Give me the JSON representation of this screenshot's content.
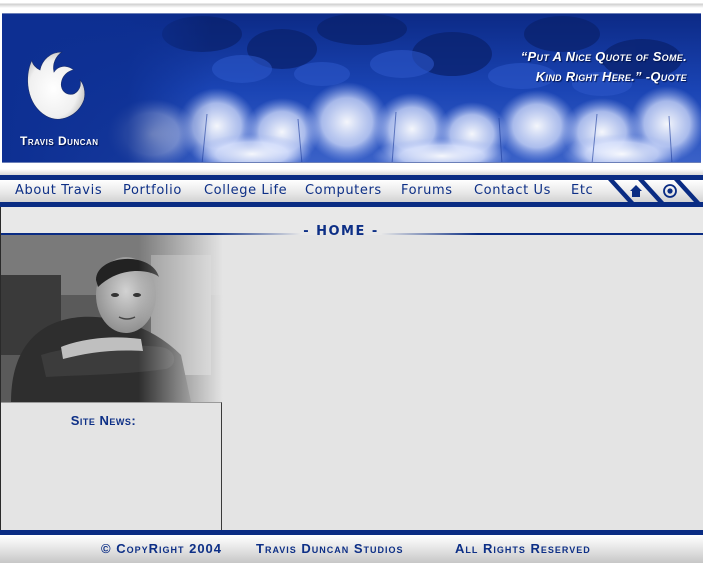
{
  "header": {
    "site_name": "Travis Duncan",
    "quote_line1": "“Put A Nice Quote of Some.",
    "quote_line2": "Kind Right Here.” -Quote"
  },
  "nav": {
    "items": [
      {
        "label": "About Travis"
      },
      {
        "label": "Portfolio"
      },
      {
        "label": "College Life"
      },
      {
        "label": "Computers"
      },
      {
        "label": "Forums"
      },
      {
        "label": "Contact Us"
      },
      {
        "label": "Etc"
      }
    ],
    "icons": [
      "home-icon",
      "target-icon"
    ]
  },
  "main": {
    "page_title": "- HOME -",
    "news_title": "Site News:"
  },
  "footer": {
    "copyright": "© CopyRight 2004",
    "studio": "Travis Duncan Studios",
    "rights": "All Rights Reserved"
  },
  "colors": {
    "brand_blue": "#0a2c83",
    "text_blue": "#0d2f86",
    "content_bg": "#e4e4e4"
  }
}
